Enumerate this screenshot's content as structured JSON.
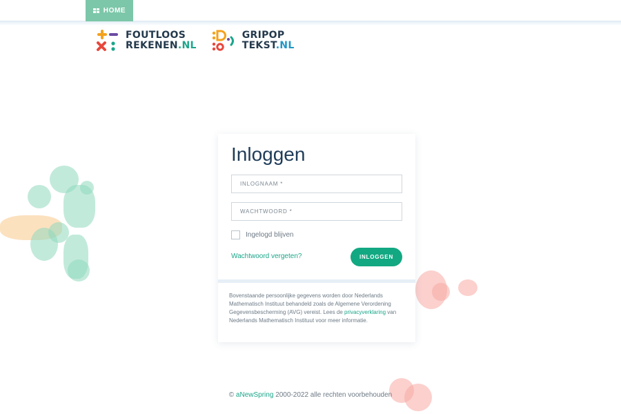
{
  "nav": {
    "home_label": "HOME"
  },
  "logos": [
    {
      "line1": "FOUTLOOS",
      "line2": "REKENEN",
      "suffix": ".NL"
    },
    {
      "line1": "GRIPOP",
      "line2": "TEKST",
      "suffix": ".NL"
    }
  ],
  "login": {
    "title": "Inloggen",
    "username_placeholder": "INLOGNAAM *",
    "password_placeholder": "WACHTWOORD *",
    "remember_label": "Ingelogd blijven",
    "forgot_link": "Wachtwoord vergeten?",
    "submit_label": "INLOGGEN"
  },
  "privacy": {
    "text_before": "Bovenstaande persoonlijke gegevens worden door Nederlands Mathematisch Instituut behandeld zoals de Algemene Verordening Gegevensbescherming (AVG) vereist. Lees de ",
    "link": "privacyverklaring",
    "text_after": " van Nederlands Mathematisch Instituut voor meer informatie."
  },
  "footer": {
    "copyright_symbol": "©",
    "brand_link": "aNewSpring",
    "rest": "2000-2022 alle rechten voorbehouden"
  },
  "colors": {
    "accent": "#12a882",
    "home_tab": "#7cc7a9",
    "title": "#1f3c58"
  }
}
